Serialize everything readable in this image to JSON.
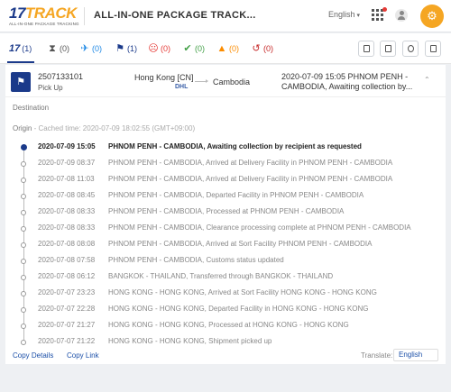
{
  "app": {
    "logo_main": "17TRACK",
    "logo_sub": "ALL-IN-ONE PACKAGE TRACKING",
    "title": "ALL-IN-ONE PACKAGE TRACK...",
    "language": "English"
  },
  "filters": [
    {
      "icon": "17",
      "count": "(1)",
      "color": "#1b3a8a"
    },
    {
      "icon": "hourglass-icon",
      "count": "(0)",
      "color": "#555555"
    },
    {
      "icon": "plane-icon",
      "count": "(0)",
      "color": "#1e88e5"
    },
    {
      "icon": "flag-icon",
      "count": "(1)",
      "color": "#1b3a8a"
    },
    {
      "icon": "sad-face-icon",
      "count": "(0)",
      "color": "#e53935"
    },
    {
      "icon": "check-icon",
      "count": "(0)",
      "color": "#43a047"
    },
    {
      "icon": "warning-icon",
      "count": "(0)",
      "color": "#fb8c00"
    },
    {
      "icon": "history-icon",
      "count": "(0)",
      "color": "#c62828"
    }
  ],
  "package": {
    "number": "2507133101",
    "status": "Pick Up",
    "origin": "Hong Kong [CN]",
    "carrier": "DHL",
    "destination": "Cambodia",
    "latest_line1": "2020-07-09 15:05  PHNOM PENH -",
    "latest_line2": "CAMBODIA, Awaiting collection by..."
  },
  "details": {
    "destination_label": "Destination",
    "origin_label": "Origin",
    "cached_time": " - Cached time: 2020-07-09 18:02:55 (GMT+09:00)"
  },
  "events": [
    {
      "time": "2020-07-09 15:05",
      "desc": "PHNOM PENH - CAMBODIA, Awaiting collection by recipient as requested"
    },
    {
      "time": "2020-07-09 08:37",
      "desc": "PHNOM PENH - CAMBODIA, Arrived at Delivery Facility in PHNOM PENH - CAMBODIA"
    },
    {
      "time": "2020-07-08 11:03",
      "desc": "PHNOM PENH - CAMBODIA, Arrived at Delivery Facility in PHNOM PENH - CAMBODIA"
    },
    {
      "time": "2020-07-08 08:45",
      "desc": "PHNOM PENH - CAMBODIA, Departed Facility in PHNOM PENH - CAMBODIA"
    },
    {
      "time": "2020-07-08 08:33",
      "desc": "PHNOM PENH - CAMBODIA, Processed at PHNOM PENH - CAMBODIA"
    },
    {
      "time": "2020-07-08 08:33",
      "desc": "PHNOM PENH - CAMBODIA, Clearance processing complete at PHNOM PENH - CAMBODIA"
    },
    {
      "time": "2020-07-08 08:08",
      "desc": "PHNOM PENH - CAMBODIA, Arrived at Sort Facility PHNOM PENH - CAMBODIA"
    },
    {
      "time": "2020-07-08 07:58",
      "desc": "PHNOM PENH - CAMBODIA, Customs status updated"
    },
    {
      "time": "2020-07-08 06:12",
      "desc": "BANGKOK - THAILAND, Transferred through BANGKOK - THAILAND"
    },
    {
      "time": "2020-07-07 23:23",
      "desc": "HONG KONG - HONG KONG, Arrived at Sort Facility HONG KONG - HONG KONG"
    },
    {
      "time": "2020-07-07 22:28",
      "desc": "HONG KONG - HONG KONG, Departed Facility in HONG KONG - HONG KONG"
    },
    {
      "time": "2020-07-07 21:27",
      "desc": "HONG KONG - HONG KONG, Processed at HONG KONG - HONG KONG"
    },
    {
      "time": "2020-07-07 21:22",
      "desc": "HONG KONG - HONG KONG, Shipment picked up"
    }
  ],
  "footer": {
    "copy_details": "Copy Details",
    "copy_link": "Copy Link",
    "translate_label": "Translate:",
    "translate_value": "English"
  }
}
